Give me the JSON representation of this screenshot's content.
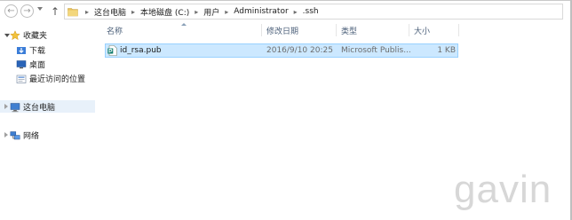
{
  "address": {
    "crumbs": [
      "这台电脑",
      "本地磁盘 (C:)",
      "用户",
      "Administrator",
      ".ssh"
    ]
  },
  "nav": {
    "favorites": "收藏夹",
    "downloads": "下载",
    "desktop": "桌面",
    "recent": "最近访问的位置",
    "this_pc": "这台电脑",
    "network": "网络"
  },
  "columns": {
    "name": "名称",
    "modified": "修改日期",
    "type": "类型",
    "size": "大小"
  },
  "files": [
    {
      "name": "id_rsa.pub",
      "modified": "2016/9/10 20:25",
      "type": "Microsoft Publis...",
      "size": "1 KB"
    }
  ],
  "watermark": "gavin",
  "colors": {
    "selection": "#cce8ff",
    "selection_border": "#99d1ff",
    "header_text": "#4c607a",
    "nav_selected": "#e8f1fa"
  }
}
